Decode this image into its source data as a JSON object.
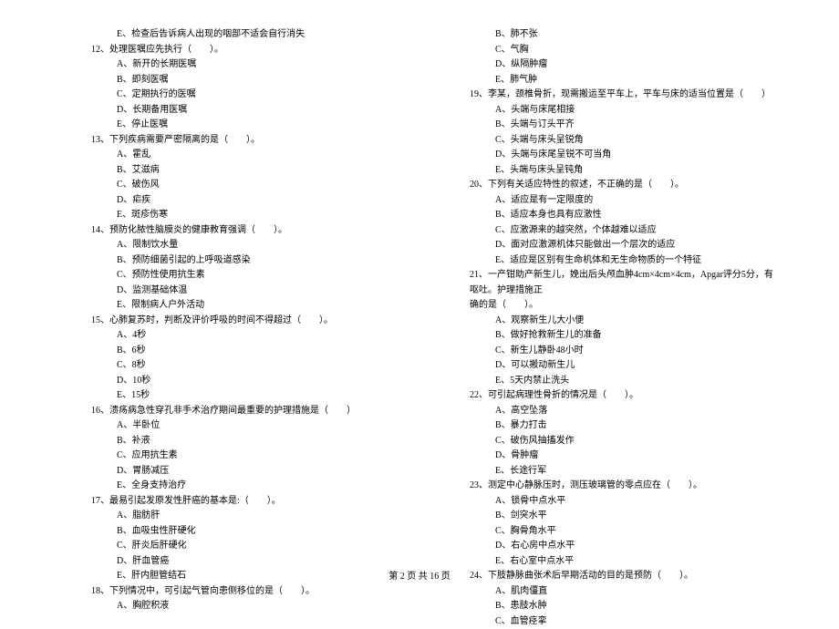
{
  "left": {
    "pre_option": "E、检查后告诉病人出现的咽部不适会自行消失",
    "questions": [
      {
        "num": "12",
        "stem": "处理医嘱应先执行（　　）。",
        "options": [
          "A、新开的长期医嘱",
          "B、即刻医嘱",
          "C、定期执行的医嘱",
          "D、长期备用医嘱",
          "E、停止医嘱"
        ]
      },
      {
        "num": "13",
        "stem": "下列疾病需要严密隔离的是（　　）。",
        "options": [
          "A、霍乱",
          "B、艾滋病",
          "C、破伤风",
          "D、疟疾",
          "E、斑疹伤寒"
        ]
      },
      {
        "num": "14",
        "stem": "预防化脓性脑膜炎的健康教育强调（　　）。",
        "options": [
          "A、限制饮水量",
          "B、预防细菌引起的上呼吸道感染",
          "C、预防性使用抗生素",
          "D、监测基础体温",
          "E、限制病人户外活动"
        ]
      },
      {
        "num": "15",
        "stem": "心肺复苏时，判断及评价呼吸的时间不得超过（　　）。",
        "options": [
          "A、4秒",
          "B、6秒",
          "C、8秒",
          "D、10秒",
          "E、15秒"
        ]
      },
      {
        "num": "16",
        "stem": "溃疡病急性穿孔非手术治疗期间最重要的护理措施是（　　）",
        "options": [
          "A、半卧位",
          "B、补液",
          "C、应用抗生素",
          "D、胃肠减压",
          "E、全身支持治疗"
        ]
      },
      {
        "num": "17",
        "stem": "最易引起发原发性肝癌的基本是:（　　）。",
        "options": [
          "A、脂肪肝",
          "B、血吸虫性肝硬化",
          "C、肝炎后肝硬化",
          "D、肝血管癌",
          "E、肝内胆管结石"
        ]
      },
      {
        "num": "18",
        "stem": "下列情况中，可引起气管向患侧移位的是（　　）。",
        "options": [
          "A、胸腔积液"
        ]
      }
    ]
  },
  "right": {
    "pre_options": [
      "B、肺不张",
      "C、气胸",
      "D、纵隔肿瘤",
      "E、肺气肿"
    ],
    "questions": [
      {
        "num": "19",
        "stem": "李某，颈椎骨折，现需搬运至平车上，平车与床的适当位置是（　　）",
        "options": [
          "A、头端与床尾相接",
          "B、头端与订头平齐",
          "C、头端与床头呈锐角",
          "D、头端与床尾呈锐不可当角",
          "E、头端与床头呈钝角"
        ]
      },
      {
        "num": "20",
        "stem": "下列有关适应特性的叙述，不正确的是（　　）。",
        "options": [
          "A、适应是有一定限度的",
          "B、适应本身也具有应激性",
          "C、应激源来的越突然，个体越难以适应",
          "D、面对应激源机体只能做出一个层次的适应",
          "E、适应是区别有生命机体和无生命物质的一个特征"
        ]
      },
      {
        "num": "21",
        "stem": "一产钳助产新生儿，娩出后头颅血肿4cm×4cm×4cm，Apgar评分5分，有呕吐。护理措施正",
        "stem_cont": "确的是（　　）。",
        "options": [
          "A、观察新生儿大小便",
          "B、做好抢救新生儿的准备",
          "C、新生儿静卧48小时",
          "D、可以搬动新生儿",
          "E、5天内禁止洗头"
        ]
      },
      {
        "num": "22",
        "stem": "可引起病理性骨折的情况是（　　）。",
        "options": [
          "A、高空坠落",
          "B、暴力打击",
          "C、破伤风抽搐发作",
          "D、骨肿瘤",
          "E、长途行军"
        ]
      },
      {
        "num": "23",
        "stem": "测定中心静脉压时，测压玻璃管的零点应在（　　）。",
        "options": [
          "A、锁骨中点水平",
          "B、剑突水平",
          "C、胸骨角水平",
          "D、右心房中点水平",
          "E、右心室中点水平"
        ]
      },
      {
        "num": "24",
        "stem": "下肢静脉曲张术后早期活动的目的是预防（　　）。",
        "options": [
          "A、肌肉僵直",
          "B、患肢水肿",
          "C、血管痉挛"
        ]
      }
    ]
  },
  "footer": "第 2 页 共 16 页"
}
